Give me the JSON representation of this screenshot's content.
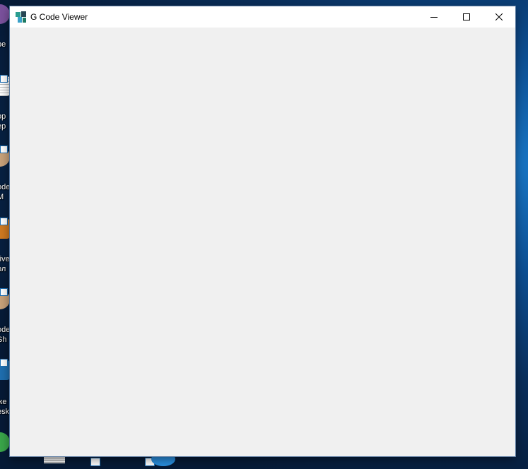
{
  "window": {
    "title": "G Code Viewer",
    "icon": "g-code-viewer-app-icon",
    "controls": [
      "minimize-icon",
      "maximize-icon",
      "close-icon"
    ]
  },
  "desktop": {
    "icons": [
      {
        "label_line1": "pe",
        "label_line2": ""
      },
      {
        "label_line1": "op",
        "label_line2": "ep"
      },
      {
        "label_line1": "ode",
        "label_line2": "M"
      },
      {
        "label_line1": "rive",
        "label_line2": "ол"
      },
      {
        "label_line1": "ode",
        "label_line2": "Sh"
      },
      {
        "label_line1": "же",
        "label_line2": "esk"
      }
    ]
  },
  "colors": {
    "window_bg": "#f0f0f0",
    "titlebar_bg": "#ffffff",
    "desktop_bg": "#0d4f93"
  }
}
